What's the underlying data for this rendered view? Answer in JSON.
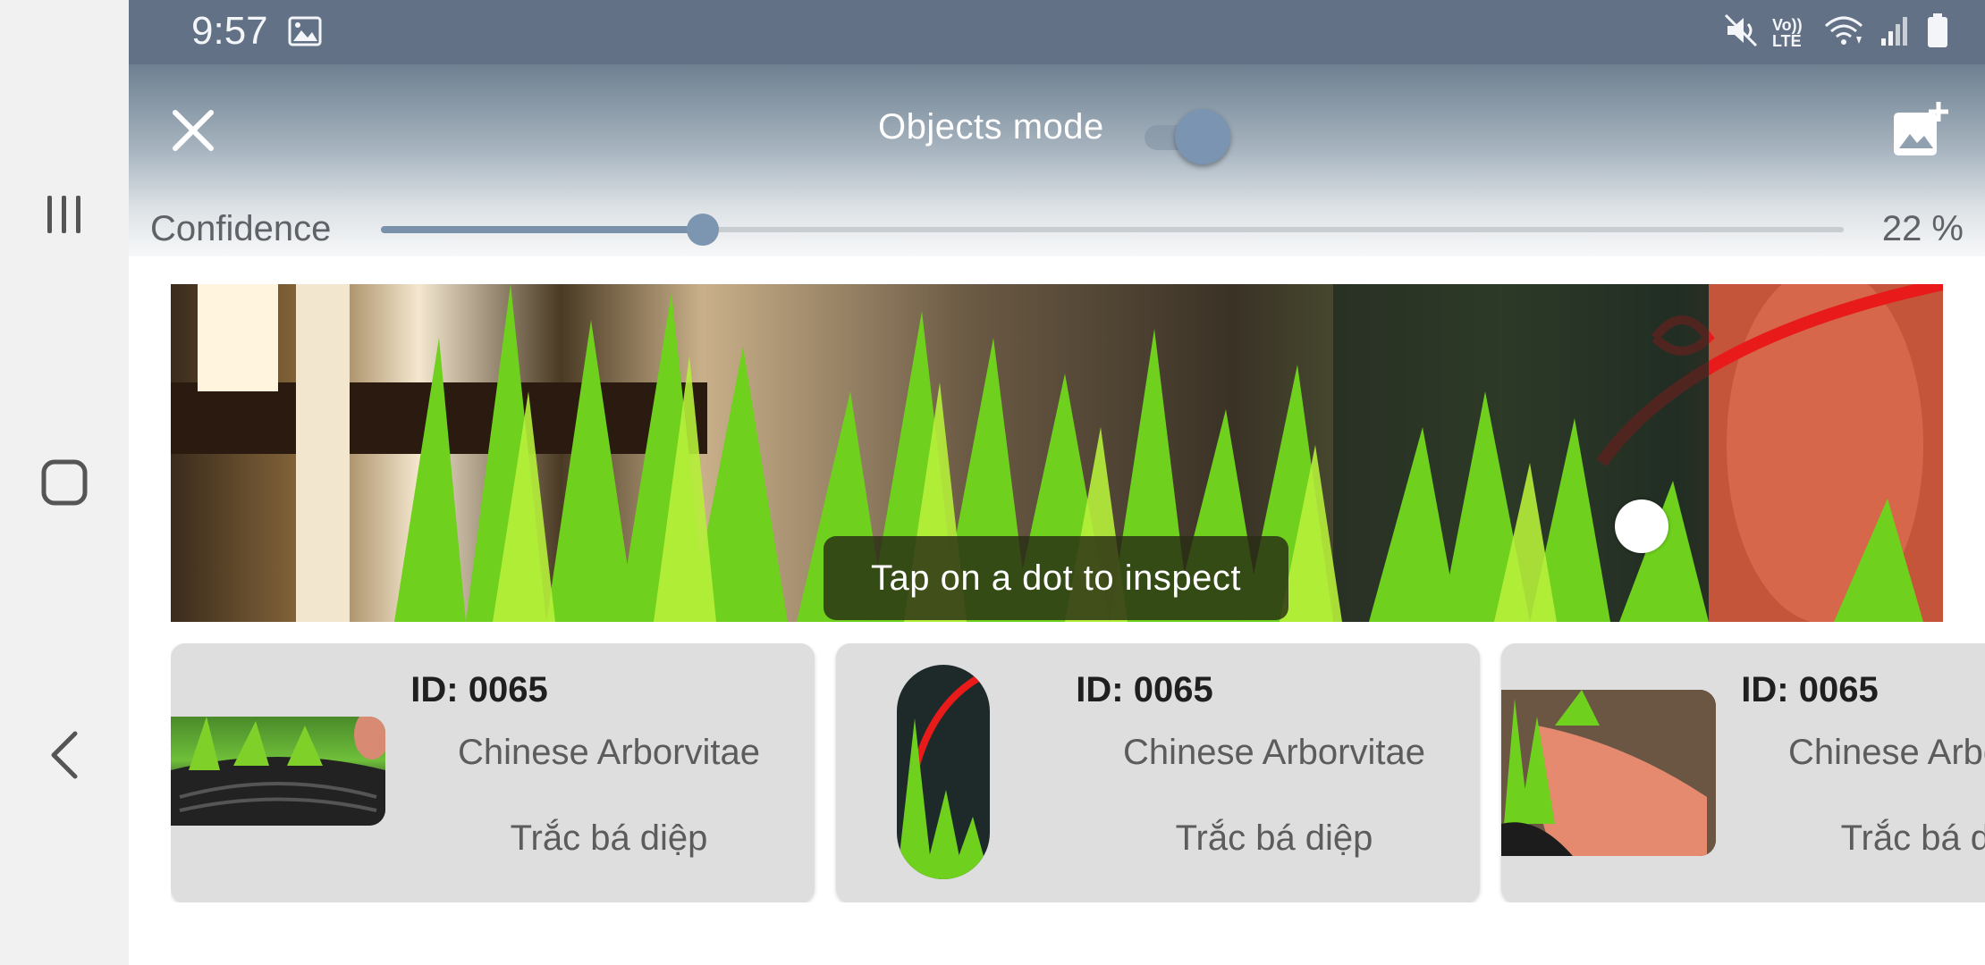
{
  "status_bar": {
    "time": "9:57",
    "icons": [
      "gallery-icon",
      "mute-icon",
      "volte-icon",
      "wifi-icon",
      "signal-icon",
      "battery-icon"
    ],
    "volte_text": "Vo)) LTE"
  },
  "toolbar": {
    "mode_label": "Objects mode",
    "mode_enabled": true,
    "confidence_label": "Confidence",
    "confidence_value_text": "22 %",
    "confidence_fraction": 0.22
  },
  "image_view": {
    "hint": "Tap on a dot to inspect"
  },
  "results": [
    {
      "id": "ID: 0065",
      "name": "Chinese Arborvitae",
      "local_name": "Trắc bá diệp"
    },
    {
      "id": "ID: 0065",
      "name": "Chinese Arborvitae",
      "local_name": "Trắc bá diệp"
    },
    {
      "id": "ID: 0065",
      "name": "Chinese Arborvitae",
      "local_name": "Trắc bá diệp"
    }
  ],
  "colors": {
    "status_bar": "#627186",
    "accent": "#7c95b0",
    "card_bg": "#dedede"
  }
}
